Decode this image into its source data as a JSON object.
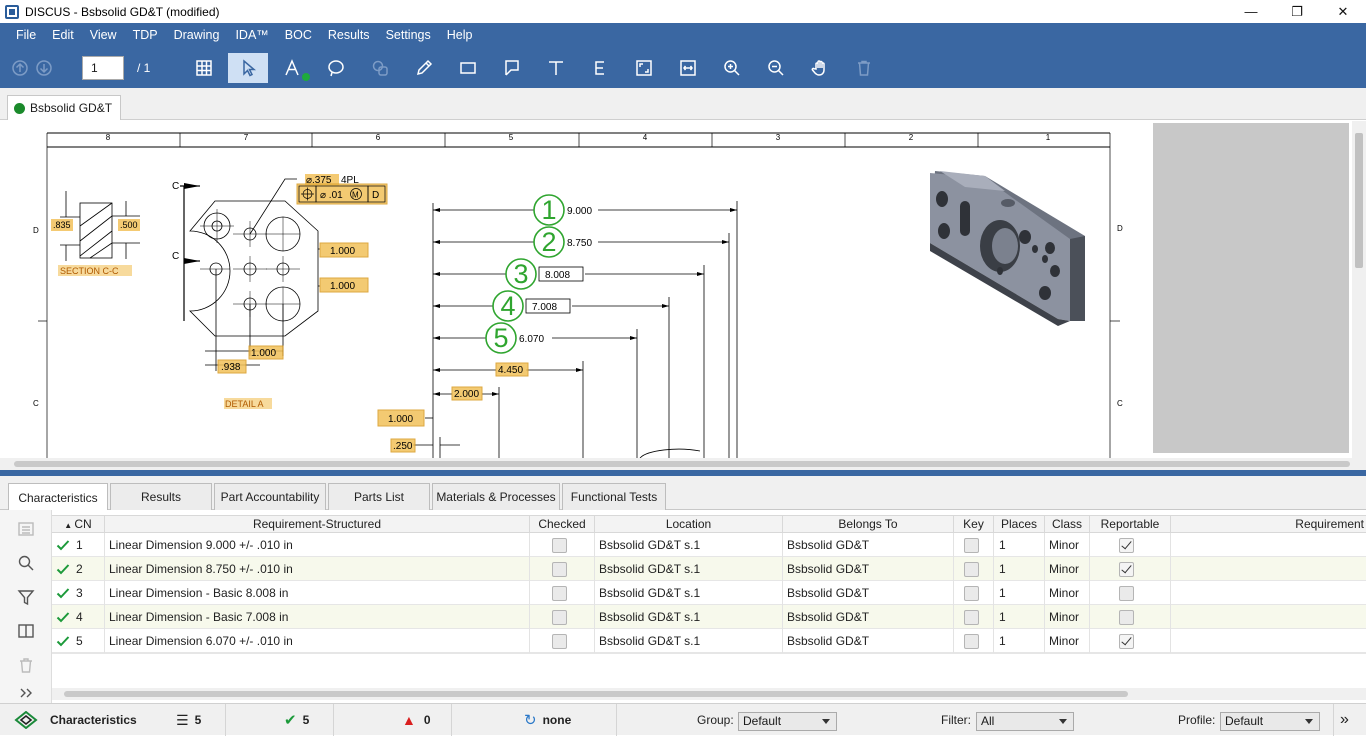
{
  "window": {
    "title": "DISCUS - Bsbsolid GD&T (modified)",
    "controls": {
      "minimize": "—",
      "restore": "❐",
      "close": "✕"
    }
  },
  "menu": [
    "File",
    "Edit",
    "View",
    "TDP",
    "Drawing",
    "IDA™",
    "BOC",
    "Results",
    "Settings",
    "Help"
  ],
  "toolbar": {
    "page_value": "1",
    "page_total": "/ 1",
    "tools": [
      "arrow-up-icon",
      "arrow-down-icon",
      "table-icon",
      "select-pointer-icon",
      "text-annotation-icon",
      "lasso-icon",
      "shapes-icon",
      "pencil-icon",
      "rectangle-icon",
      "flag-icon",
      "text-icon",
      "e-icon",
      "fit-page-icon",
      "fit-width-icon",
      "zoom-in-icon",
      "zoom-out-icon",
      "pan-hand-icon",
      "trash-icon"
    ]
  },
  "doc_tab": {
    "label": "Bsbsolid GD&T",
    "status_color": "#1a8a2b"
  },
  "drawing": {
    "ruler_top": [
      "8",
      "7",
      "6",
      "5",
      "4",
      "3",
      "2",
      "1"
    ],
    "zone_left": [
      "D",
      "C"
    ],
    "zone_right": [
      "D",
      "C"
    ],
    "section_label": "SECTION C-C",
    "detail_label": "DETAIL A",
    "section_marker": "C",
    "dims_left": {
      "d835": ".835",
      "d500": ".500",
      "hole": "⌀.375",
      "hole_qty": "4PL",
      "fcf_tol": "⌀ .01",
      "fcf_mod": "M",
      "fcf_datum": "D",
      "d1000a": "1.000",
      "d1000b": "1.000",
      "d1000c": "1.000",
      "d938": ".938"
    },
    "balloons": [
      {
        "num": "1",
        "value": "9.000",
        "boxed": false
      },
      {
        "num": "2",
        "value": "8.750",
        "boxed": false
      },
      {
        "num": "3",
        "value": "8.008",
        "boxed": true
      },
      {
        "num": "4",
        "value": "7.008",
        "boxed": true
      },
      {
        "num": "5",
        "value": "6.070",
        "boxed": false
      }
    ],
    "dims_ordinate": {
      "d4450": "4.450",
      "d2000": "2.000",
      "d1000": "1.000",
      "d250": ".250"
    },
    "balloon_color": "#2fa52f",
    "highlight_color": "#f2c15a"
  },
  "bottom_tabs": [
    "Characteristics",
    "Results",
    "Part Accountability",
    "Parts List",
    "Materials & Processes",
    "Functional Tests"
  ],
  "grid": {
    "columns": [
      "CN",
      "Requirement-Structured",
      "Checked",
      "Location",
      "Belongs To",
      "Key",
      "Places",
      "Class",
      "Reportable",
      "Requirement"
    ],
    "rows": [
      {
        "cn": "1",
        "req": "Linear Dimension 9.000 +/- .010 in",
        "checked": false,
        "location": "Bsbsolid GD&T s.1",
        "belongs": "Bsbsolid GD&T",
        "key": false,
        "places": "1",
        "class": "Minor",
        "reportable": true
      },
      {
        "cn": "2",
        "req": "Linear Dimension 8.750 +/- .010 in",
        "checked": false,
        "location": "Bsbsolid GD&T s.1",
        "belongs": "Bsbsolid GD&T",
        "key": false,
        "places": "1",
        "class": "Minor",
        "reportable": true
      },
      {
        "cn": "3",
        "req": "Linear Dimension - Basic 8.008 in",
        "checked": false,
        "location": "Bsbsolid GD&T s.1",
        "belongs": "Bsbsolid GD&T",
        "key": false,
        "places": "1",
        "class": "Minor",
        "reportable": false
      },
      {
        "cn": "4",
        "req": "Linear Dimension - Basic 7.008 in",
        "checked": false,
        "location": "Bsbsolid GD&T s.1",
        "belongs": "Bsbsolid GD&T",
        "key": false,
        "places": "1",
        "class": "Minor",
        "reportable": false
      },
      {
        "cn": "5",
        "req": "Linear Dimension 6.070 +/- .010 in",
        "checked": false,
        "location": "Bsbsolid GD&T s.1",
        "belongs": "Bsbsolid GD&T",
        "key": false,
        "places": "1",
        "class": "Minor",
        "reportable": true
      }
    ]
  },
  "statusbar": {
    "title": "Characteristics",
    "count_total": "5",
    "count_ok": "5",
    "count_warn": "0",
    "sync": "none",
    "group_label": "Group:",
    "group_value": "Default",
    "filter_label": "Filter:",
    "filter_value": "All",
    "profile_label": "Profile:",
    "profile_value": "Default",
    "more": "»"
  }
}
